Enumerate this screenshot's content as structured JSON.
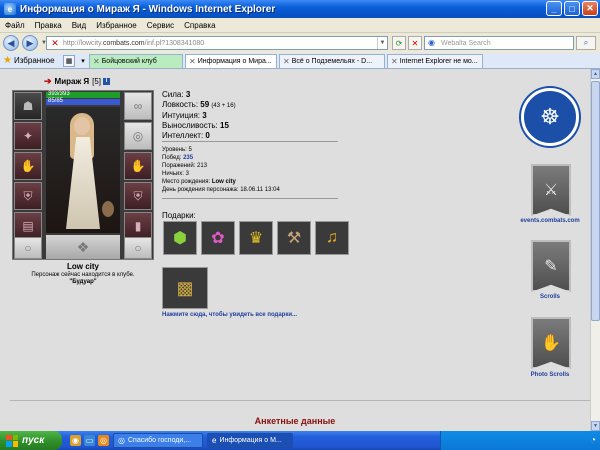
{
  "window": {
    "title": "Информация о Мираж Я - Windows Internet Explorer"
  },
  "menu": [
    "Файл",
    "Правка",
    "Вид",
    "Избранное",
    "Сервис",
    "Справка"
  ],
  "address": {
    "url_prefix": "http://lowcity.",
    "url_domain": "combats.com",
    "url_suffix": "/inf.pl?1308341080"
  },
  "search": {
    "placeholder": "Webalta Search"
  },
  "favorites_label": "Избранное",
  "tabs": [
    {
      "label": "Бойцовский клуб",
      "style": "green"
    },
    {
      "label": "Информация о Мира...",
      "style": "active"
    },
    {
      "label": "Всё о Подземельях - D...",
      "style": "normal"
    },
    {
      "label": "Internet Explorer не мо...",
      "style": "normal"
    }
  ],
  "character": {
    "nick": "Мираж Я",
    "level": "[5]",
    "info_badge": "i",
    "hp": "393/393",
    "mp": "85/85",
    "name": "Low city",
    "location": "Персонаж сейчас находится в клубе.",
    "room": "\"Будуар\""
  },
  "stats": {
    "strength_label": "Сила:",
    "strength": "3",
    "agility_label": "Ловкость:",
    "agility": "59",
    "agility_bonus": "(43 + 16)",
    "intuition_label": "Интуиция:",
    "intuition": "3",
    "stamina_label": "Выносливость:",
    "stamina": "15",
    "intellect_label": "Интеллект:",
    "intellect": "0"
  },
  "info": {
    "level_label": "Уровень:",
    "level": "5",
    "wins_label": "Побед:",
    "wins": "235",
    "losses_label": "Поражений:",
    "losses": "213",
    "draws_label": "Ничьих:",
    "draws": "3",
    "birthplace_label": "Место рождения:",
    "birthplace": "Low city",
    "birthday_label": "День рождения персонажа:",
    "birthday": "18.06.11 13:04"
  },
  "gifts": {
    "label": "Подарки:",
    "link": "Нажмите сюда, чтобы увидеть все подарки..."
  },
  "sidebar": {
    "links": [
      "events.combats.com",
      "Scrolls",
      "Photo Scrolls"
    ]
  },
  "section_title": "Анкетные данные",
  "taskbar": {
    "start": "пуск",
    "items": [
      "Спасибо господи,...",
      "Информация о М..."
    ]
  },
  "colors": {
    "link": "#1e3f9e",
    "section_title": "#8a1010",
    "content_bg": "#dedede"
  }
}
